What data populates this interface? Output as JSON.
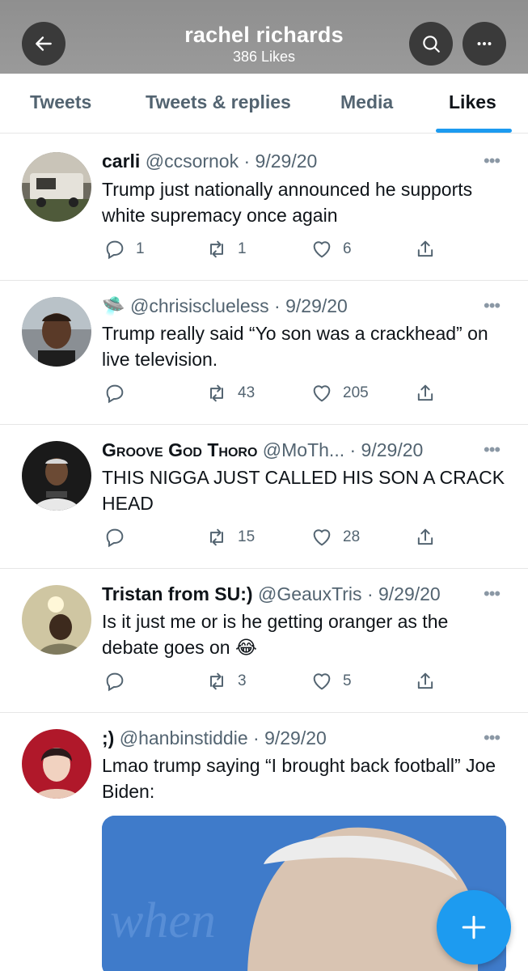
{
  "header": {
    "title": "rachel richards",
    "subtitle": "386 Likes"
  },
  "tabs": [
    {
      "label": "Tweets"
    },
    {
      "label": "Tweets & replies"
    },
    {
      "label": "Media"
    },
    {
      "label": "Likes"
    }
  ],
  "active_tab": "Likes",
  "tweets": [
    {
      "name": "carli",
      "handle": "@ccsornok",
      "date": "· 9/29/20",
      "text": "Trump just nationally announced he supports white supremacy once again",
      "replies": "1",
      "retweets": "1",
      "likes": "6"
    },
    {
      "name": "🛸",
      "handle": "@chrisisclueless",
      "date": "· 9/29/20",
      "text": "Trump really said “Yo son was a crackhead” on live television.",
      "replies": "",
      "retweets": "43",
      "likes": "205"
    },
    {
      "name": "Groove God Thoro",
      "handle": "@MoTh...",
      "date": "· 9/29/20",
      "text": "THIS NIGGA JUST CALLED HIS SON A CRACK HEAD",
      "replies": "",
      "retweets": "15",
      "likes": "28"
    },
    {
      "name": "Tristan from SU:)",
      "handle": "@GeauxTris",
      "date": "· 9/29/20",
      "text": "Is it just me or is he getting oranger as the debate goes on 😂",
      "replies": "",
      "retweets": "3",
      "likes": "5"
    },
    {
      "name": ";)",
      "handle": "@hanbinstiddie",
      "date": "· 9/29/20",
      "text": "Lmao trump saying “I brought back football” Joe Biden:",
      "replies": "",
      "retweets": "",
      "likes": ""
    }
  ],
  "colors": {
    "accent": "#1d9bf0",
    "header_bg": "#969696",
    "secondary_text": "#536471"
  },
  "icons": {
    "back": "arrow-left-icon",
    "search": "search-icon",
    "more": "more-horizontal-icon",
    "reply": "reply-icon",
    "retweet": "retweet-icon",
    "like": "heart-icon",
    "share": "share-icon",
    "compose": "plus-icon"
  }
}
